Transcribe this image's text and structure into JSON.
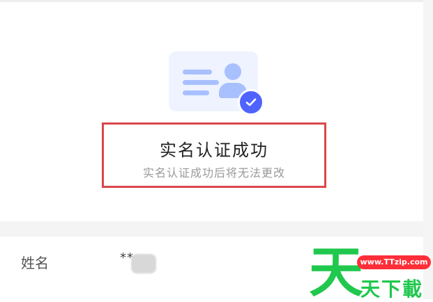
{
  "verification": {
    "title": "实名认证成功",
    "subtitle": "实名认证成功后将无法更改"
  },
  "profile": {
    "name_label": "姓名",
    "name_value": "**"
  },
  "watermark": {
    "url": "www.TTzip.com",
    "brand": "天下載",
    "logo_glyph": "天"
  },
  "colors": {
    "accent": "#4f63ff",
    "card_background": "#eef3ff",
    "card_shapes": "#a9c0ff",
    "highlight_border": "#d9474a",
    "watermark_green": "#20c84d",
    "watermark_red": "#ff2f39"
  },
  "icons": {
    "id_card": "id-card-icon",
    "check": "check-badge-icon"
  }
}
